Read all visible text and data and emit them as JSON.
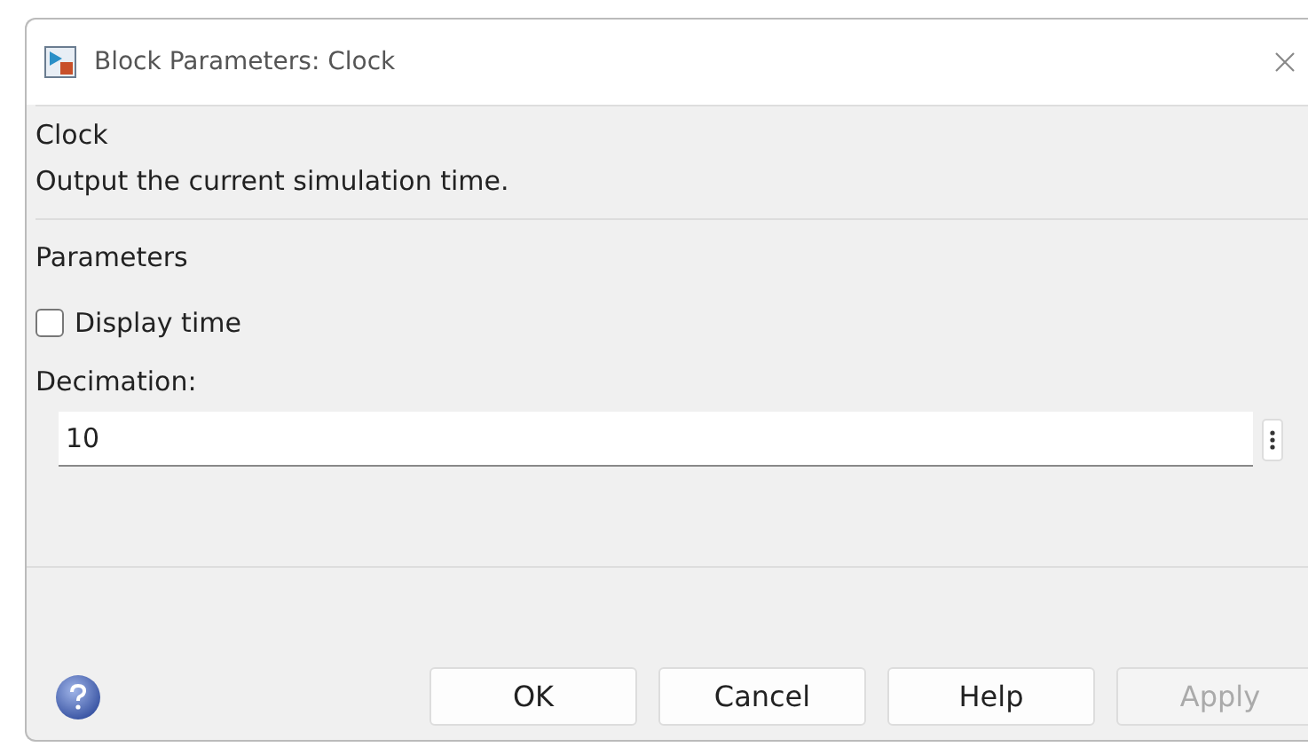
{
  "window": {
    "title": "Block Parameters: Clock"
  },
  "block": {
    "name": "Clock",
    "description": "Output the current simulation time."
  },
  "parameters": {
    "title": "Parameters",
    "checkbox": {
      "label": "Display time",
      "checked": false
    },
    "field": {
      "label": "Decimation:",
      "value": "10"
    }
  },
  "buttons": [
    {
      "label": "OK",
      "disabled": false
    },
    {
      "label": "Cancel",
      "disabled": false
    },
    {
      "label": "Help",
      "disabled": false
    },
    {
      "label": "Apply",
      "disabled": true
    }
  ]
}
